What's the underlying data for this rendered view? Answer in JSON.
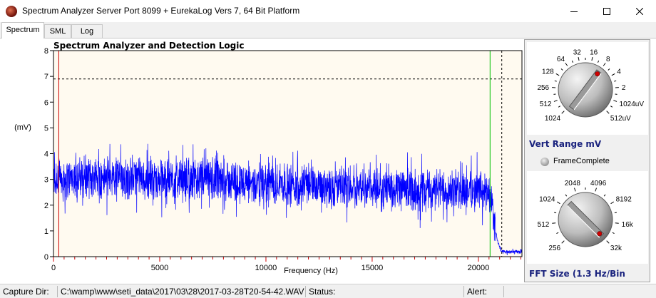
{
  "window": {
    "title": "Spectrum Analyzer Server Port 8099 + EurekaLog Vers 7,  64 Bit Platform"
  },
  "tabs": [
    {
      "label": "Spectrum",
      "active": true
    },
    {
      "label": "SML",
      "active": false
    },
    {
      "label": "Log",
      "active": false
    }
  ],
  "chart_data": {
    "type": "line",
    "title": "Spectrum Analyzer and Detection Logic",
    "xlabel": "Frequency (Hz)",
    "ylabel": "(mV)",
    "xlim": [
      0,
      22050
    ],
    "ylim": [
      0,
      8
    ],
    "xticks": [
      0,
      5000,
      10000,
      15000,
      20000
    ],
    "yticks": [
      0,
      1,
      2,
      3,
      4,
      5,
      6,
      7,
      8
    ],
    "series": [
      {
        "name": "",
        "color": "#0000ff",
        "envelope_x": [
          0,
          2000,
          5000,
          8000,
          10000,
          13000,
          15000,
          18000,
          20000,
          20500,
          20700,
          20900,
          21100,
          22050
        ],
        "envelope_y": [
          3.0,
          3.1,
          3.0,
          2.95,
          2.85,
          2.75,
          2.65,
          2.6,
          2.55,
          2.5,
          1.6,
          0.6,
          0.18,
          0.18
        ],
        "noise_mV": 1.5
      }
    ],
    "threshold_y": 6.9,
    "markers": [
      {
        "x": 250,
        "color": "#d00000",
        "style": "solid"
      },
      {
        "x": 20550,
        "color": "#00c000",
        "style": "solid"
      },
      {
        "x": 21100,
        "color": "#000000",
        "style": "dashed"
      }
    ],
    "background": "#fffaf0",
    "grid": false
  },
  "vert_range": {
    "label": "Vert Range mV",
    "options": [
      "1024",
      "512",
      "256",
      "128",
      "64",
      "32",
      "16",
      "8",
      "4",
      "2",
      "1024uV",
      "512uV"
    ],
    "selected": "8"
  },
  "frame_complete": {
    "label": "FrameComplete"
  },
  "fft_size": {
    "label": "FFT Size (1.3 Hz/Bin",
    "options": [
      "256",
      "512",
      "1024",
      "2048",
      "4096",
      "8192",
      "16k",
      "32k"
    ],
    "selected": "32k"
  },
  "status": {
    "capture_dir_label": "Capture Dir:",
    "capture_dir_value": "C:\\wamp\\www\\seti_data\\2017\\03\\28\\2017-03-28T20-54-42.WAV",
    "status_label": "Status:",
    "alert_label": "Alert:"
  },
  "colors": {
    "accent": "#1a237e",
    "trace": "#0000ff",
    "plot_bg": "#fffaf0"
  },
  "icons": {
    "app": "spectrum-app-icon",
    "minimize": "minimize-icon",
    "maximize": "maximize-icon",
    "close": "close-icon"
  }
}
